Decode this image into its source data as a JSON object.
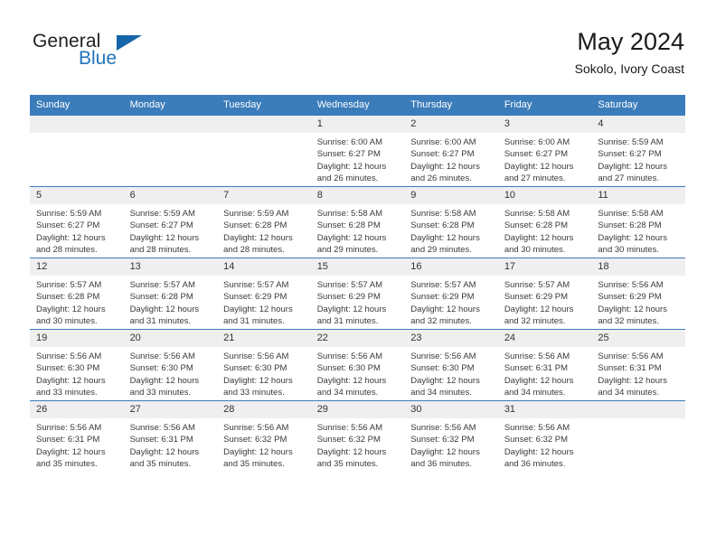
{
  "brand": {
    "name_primary": "General",
    "name_secondary": "Blue",
    "accent_color": "#2272bb",
    "triangle_color": "#1565a8"
  },
  "header": {
    "month_title": "May 2024",
    "location": "Sokolo, Ivory Coast"
  },
  "calendar": {
    "header_bg": "#3b7cba",
    "header_text_color": "#ffffff",
    "daynum_bg": "#efefef",
    "weekdays": [
      "Sunday",
      "Monday",
      "Tuesday",
      "Wednesday",
      "Thursday",
      "Friday",
      "Saturday"
    ],
    "weeks": [
      [
        {
          "day": "",
          "empty": true,
          "sunrise": "",
          "sunset": "",
          "daylight_line1": "",
          "daylight_line2": ""
        },
        {
          "day": "",
          "empty": true,
          "sunrise": "",
          "sunset": "",
          "daylight_line1": "",
          "daylight_line2": ""
        },
        {
          "day": "",
          "empty": true,
          "sunrise": "",
          "sunset": "",
          "daylight_line1": "",
          "daylight_line2": ""
        },
        {
          "day": "1",
          "empty": false,
          "sunrise": "Sunrise: 6:00 AM",
          "sunset": "Sunset: 6:27 PM",
          "daylight_line1": "Daylight: 12 hours",
          "daylight_line2": "and 26 minutes."
        },
        {
          "day": "2",
          "empty": false,
          "sunrise": "Sunrise: 6:00 AM",
          "sunset": "Sunset: 6:27 PM",
          "daylight_line1": "Daylight: 12 hours",
          "daylight_line2": "and 26 minutes."
        },
        {
          "day": "3",
          "empty": false,
          "sunrise": "Sunrise: 6:00 AM",
          "sunset": "Sunset: 6:27 PM",
          "daylight_line1": "Daylight: 12 hours",
          "daylight_line2": "and 27 minutes."
        },
        {
          "day": "4",
          "empty": false,
          "sunrise": "Sunrise: 5:59 AM",
          "sunset": "Sunset: 6:27 PM",
          "daylight_line1": "Daylight: 12 hours",
          "daylight_line2": "and 27 minutes."
        }
      ],
      [
        {
          "day": "5",
          "empty": false,
          "sunrise": "Sunrise: 5:59 AM",
          "sunset": "Sunset: 6:27 PM",
          "daylight_line1": "Daylight: 12 hours",
          "daylight_line2": "and 28 minutes."
        },
        {
          "day": "6",
          "empty": false,
          "sunrise": "Sunrise: 5:59 AM",
          "sunset": "Sunset: 6:27 PM",
          "daylight_line1": "Daylight: 12 hours",
          "daylight_line2": "and 28 minutes."
        },
        {
          "day": "7",
          "empty": false,
          "sunrise": "Sunrise: 5:59 AM",
          "sunset": "Sunset: 6:28 PM",
          "daylight_line1": "Daylight: 12 hours",
          "daylight_line2": "and 28 minutes."
        },
        {
          "day": "8",
          "empty": false,
          "sunrise": "Sunrise: 5:58 AM",
          "sunset": "Sunset: 6:28 PM",
          "daylight_line1": "Daylight: 12 hours",
          "daylight_line2": "and 29 minutes."
        },
        {
          "day": "9",
          "empty": false,
          "sunrise": "Sunrise: 5:58 AM",
          "sunset": "Sunset: 6:28 PM",
          "daylight_line1": "Daylight: 12 hours",
          "daylight_line2": "and 29 minutes."
        },
        {
          "day": "10",
          "empty": false,
          "sunrise": "Sunrise: 5:58 AM",
          "sunset": "Sunset: 6:28 PM",
          "daylight_line1": "Daylight: 12 hours",
          "daylight_line2": "and 30 minutes."
        },
        {
          "day": "11",
          "empty": false,
          "sunrise": "Sunrise: 5:58 AM",
          "sunset": "Sunset: 6:28 PM",
          "daylight_line1": "Daylight: 12 hours",
          "daylight_line2": "and 30 minutes."
        }
      ],
      [
        {
          "day": "12",
          "empty": false,
          "sunrise": "Sunrise: 5:57 AM",
          "sunset": "Sunset: 6:28 PM",
          "daylight_line1": "Daylight: 12 hours",
          "daylight_line2": "and 30 minutes."
        },
        {
          "day": "13",
          "empty": false,
          "sunrise": "Sunrise: 5:57 AM",
          "sunset": "Sunset: 6:28 PM",
          "daylight_line1": "Daylight: 12 hours",
          "daylight_line2": "and 31 minutes."
        },
        {
          "day": "14",
          "empty": false,
          "sunrise": "Sunrise: 5:57 AM",
          "sunset": "Sunset: 6:29 PM",
          "daylight_line1": "Daylight: 12 hours",
          "daylight_line2": "and 31 minutes."
        },
        {
          "day": "15",
          "empty": false,
          "sunrise": "Sunrise: 5:57 AM",
          "sunset": "Sunset: 6:29 PM",
          "daylight_line1": "Daylight: 12 hours",
          "daylight_line2": "and 31 minutes."
        },
        {
          "day": "16",
          "empty": false,
          "sunrise": "Sunrise: 5:57 AM",
          "sunset": "Sunset: 6:29 PM",
          "daylight_line1": "Daylight: 12 hours",
          "daylight_line2": "and 32 minutes."
        },
        {
          "day": "17",
          "empty": false,
          "sunrise": "Sunrise: 5:57 AM",
          "sunset": "Sunset: 6:29 PM",
          "daylight_line1": "Daylight: 12 hours",
          "daylight_line2": "and 32 minutes."
        },
        {
          "day": "18",
          "empty": false,
          "sunrise": "Sunrise: 5:56 AM",
          "sunset": "Sunset: 6:29 PM",
          "daylight_line1": "Daylight: 12 hours",
          "daylight_line2": "and 32 minutes."
        }
      ],
      [
        {
          "day": "19",
          "empty": false,
          "sunrise": "Sunrise: 5:56 AM",
          "sunset": "Sunset: 6:30 PM",
          "daylight_line1": "Daylight: 12 hours",
          "daylight_line2": "and 33 minutes."
        },
        {
          "day": "20",
          "empty": false,
          "sunrise": "Sunrise: 5:56 AM",
          "sunset": "Sunset: 6:30 PM",
          "daylight_line1": "Daylight: 12 hours",
          "daylight_line2": "and 33 minutes."
        },
        {
          "day": "21",
          "empty": false,
          "sunrise": "Sunrise: 5:56 AM",
          "sunset": "Sunset: 6:30 PM",
          "daylight_line1": "Daylight: 12 hours",
          "daylight_line2": "and 33 minutes."
        },
        {
          "day": "22",
          "empty": false,
          "sunrise": "Sunrise: 5:56 AM",
          "sunset": "Sunset: 6:30 PM",
          "daylight_line1": "Daylight: 12 hours",
          "daylight_line2": "and 34 minutes."
        },
        {
          "day": "23",
          "empty": false,
          "sunrise": "Sunrise: 5:56 AM",
          "sunset": "Sunset: 6:30 PM",
          "daylight_line1": "Daylight: 12 hours",
          "daylight_line2": "and 34 minutes."
        },
        {
          "day": "24",
          "empty": false,
          "sunrise": "Sunrise: 5:56 AM",
          "sunset": "Sunset: 6:31 PM",
          "daylight_line1": "Daylight: 12 hours",
          "daylight_line2": "and 34 minutes."
        },
        {
          "day": "25",
          "empty": false,
          "sunrise": "Sunrise: 5:56 AM",
          "sunset": "Sunset: 6:31 PM",
          "daylight_line1": "Daylight: 12 hours",
          "daylight_line2": "and 34 minutes."
        }
      ],
      [
        {
          "day": "26",
          "empty": false,
          "sunrise": "Sunrise: 5:56 AM",
          "sunset": "Sunset: 6:31 PM",
          "daylight_line1": "Daylight: 12 hours",
          "daylight_line2": "and 35 minutes."
        },
        {
          "day": "27",
          "empty": false,
          "sunrise": "Sunrise: 5:56 AM",
          "sunset": "Sunset: 6:31 PM",
          "daylight_line1": "Daylight: 12 hours",
          "daylight_line2": "and 35 minutes."
        },
        {
          "day": "28",
          "empty": false,
          "sunrise": "Sunrise: 5:56 AM",
          "sunset": "Sunset: 6:32 PM",
          "daylight_line1": "Daylight: 12 hours",
          "daylight_line2": "and 35 minutes."
        },
        {
          "day": "29",
          "empty": false,
          "sunrise": "Sunrise: 5:56 AM",
          "sunset": "Sunset: 6:32 PM",
          "daylight_line1": "Daylight: 12 hours",
          "daylight_line2": "and 35 minutes."
        },
        {
          "day": "30",
          "empty": false,
          "sunrise": "Sunrise: 5:56 AM",
          "sunset": "Sunset: 6:32 PM",
          "daylight_line1": "Daylight: 12 hours",
          "daylight_line2": "and 36 minutes."
        },
        {
          "day": "31",
          "empty": false,
          "sunrise": "Sunrise: 5:56 AM",
          "sunset": "Sunset: 6:32 PM",
          "daylight_line1": "Daylight: 12 hours",
          "daylight_line2": "and 36 minutes."
        },
        {
          "day": "",
          "empty": true,
          "sunrise": "",
          "sunset": "",
          "daylight_line1": "",
          "daylight_line2": ""
        }
      ]
    ]
  }
}
